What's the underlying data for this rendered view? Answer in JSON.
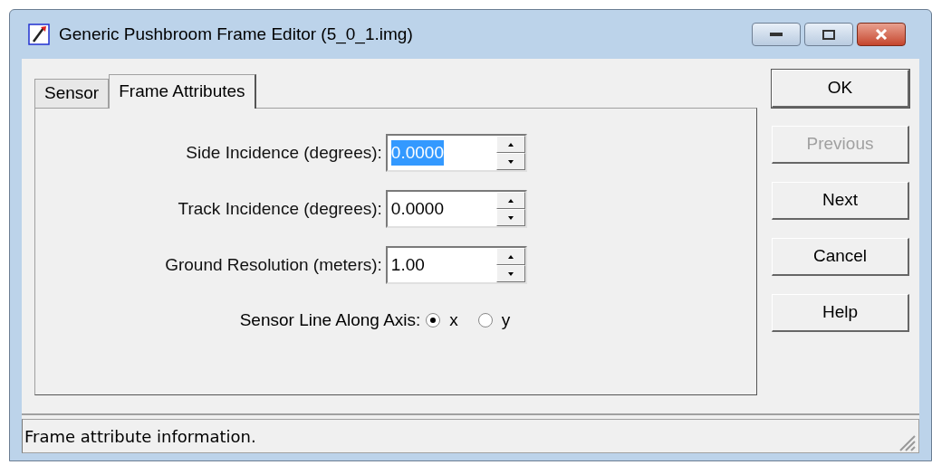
{
  "window": {
    "title": "Generic Pushbroom Frame Editor (5_0_1.img)"
  },
  "tabs": [
    {
      "label": "Sensor",
      "selected": false
    },
    {
      "label": "Frame Attributes",
      "selected": true
    }
  ],
  "fields": [
    {
      "label": "Side Incidence (degrees):",
      "value": "0.0000",
      "text_selected": true
    },
    {
      "label": "Track Incidence (degrees):",
      "value": "0.0000",
      "text_selected": false
    },
    {
      "label": "Ground Resolution (meters):",
      "value": "1.00",
      "text_selected": false
    }
  ],
  "axis": {
    "label": "Sensor Line Along Axis:",
    "options": [
      {
        "label": "x",
        "selected": true
      },
      {
        "label": "y",
        "selected": false
      }
    ]
  },
  "buttons": [
    {
      "label": "OK",
      "default": true,
      "disabled": false
    },
    {
      "label": "Previous",
      "default": false,
      "disabled": true
    },
    {
      "label": "Next",
      "default": false,
      "disabled": false
    },
    {
      "label": "Cancel",
      "default": false,
      "disabled": false
    },
    {
      "label": "Help",
      "default": false,
      "disabled": false
    }
  ],
  "status_bar": "Frame attribute information."
}
